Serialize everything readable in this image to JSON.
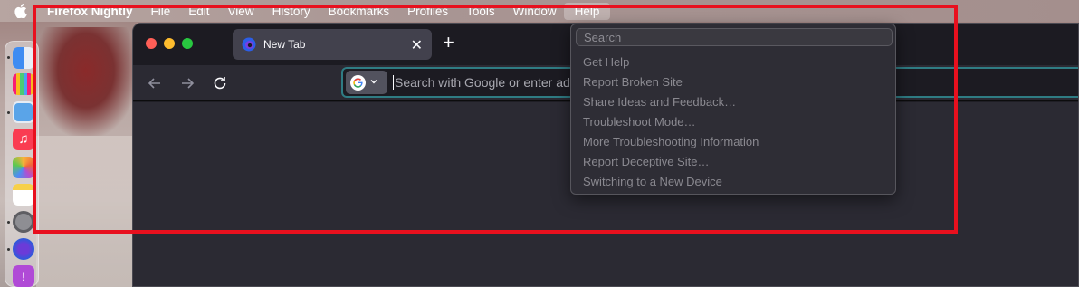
{
  "menubar": {
    "app_name": "Firefox Nightly",
    "items": [
      "File",
      "Edit",
      "View",
      "History",
      "Bookmarks",
      "Profiles",
      "Tools",
      "Window",
      "Help"
    ]
  },
  "browser": {
    "tab_title": "New Tab",
    "url_placeholder": "Search with Google or enter address"
  },
  "help_menu": {
    "search_placeholder": "Search",
    "items": [
      "Get Help",
      "Report Broken Site",
      "Share Ideas and Feedback…",
      "Troubleshoot Mode…",
      "More Troubleshooting Information",
      "Report Deceptive Site…",
      "Switching to a New Device"
    ]
  },
  "colors": {
    "highlight_frame": "#e8101e",
    "url_focus": "#2f7c84"
  }
}
